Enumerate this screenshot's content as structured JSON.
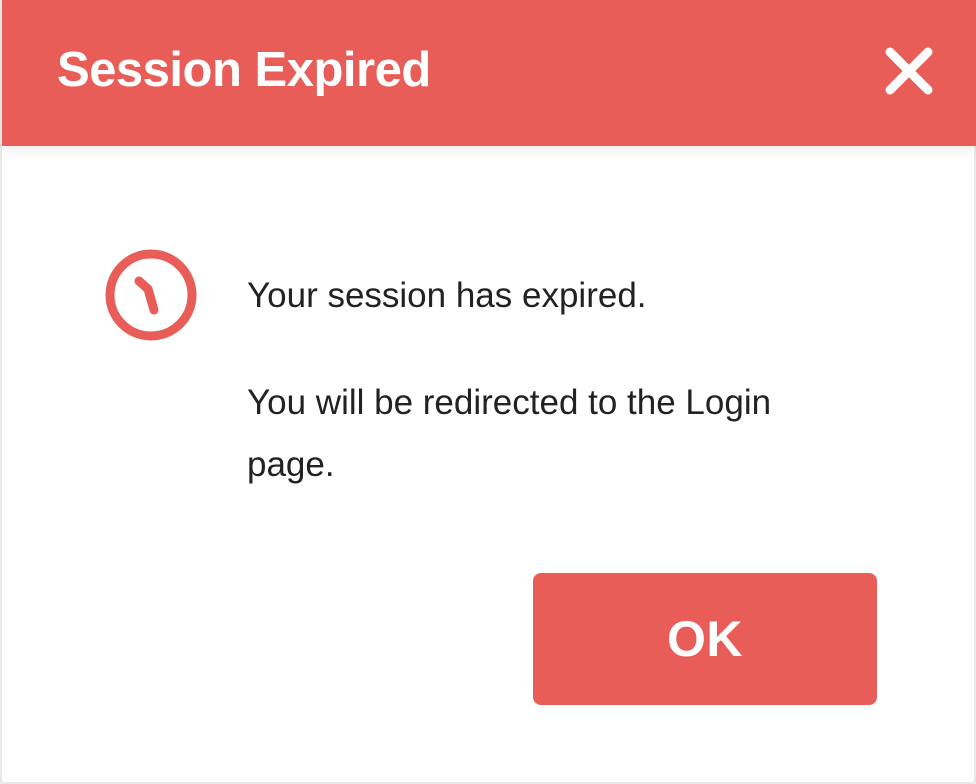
{
  "dialog": {
    "title": "Session Expired",
    "close_icon": "close-icon",
    "status_icon": "clock-icon",
    "message_line1": "Your session has expired.",
    "message_line2": "You will be redirected to the Login page.",
    "ok_label": "OK"
  },
  "colors": {
    "accent": "#e85d58",
    "text": "#222222",
    "background": "#ffffff"
  }
}
